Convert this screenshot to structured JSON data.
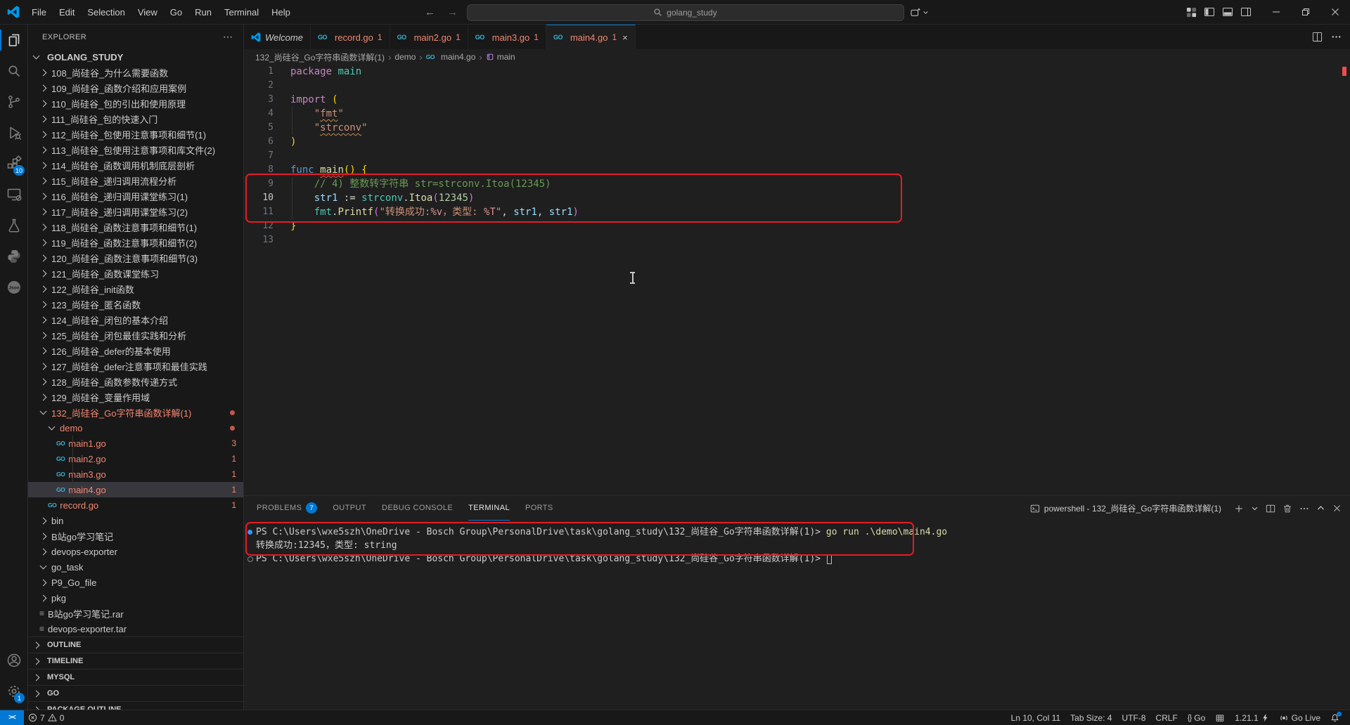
{
  "colors": {
    "accent": "#0078d4",
    "error": "#f14c4c",
    "tree_error": "#f48771",
    "annotation": "#e51c24",
    "go_icon": "#35b5d6",
    "terminal_command": "#dcdcaa"
  },
  "window": {
    "menus": [
      "File",
      "Edit",
      "Selection",
      "View",
      "Go",
      "Run",
      "Terminal",
      "Help"
    ],
    "search_text": "golang_study",
    "nav": {
      "back": "←",
      "forward": "→"
    }
  },
  "activity_bar": {
    "top": [
      {
        "name": "explorer",
        "active": true
      },
      {
        "name": "search"
      },
      {
        "name": "source-control"
      },
      {
        "name": "run-debug"
      },
      {
        "name": "extensions",
        "badge": "10"
      },
      {
        "name": "remote-explorer"
      },
      {
        "name": "testing"
      },
      {
        "name": "python"
      },
      {
        "name": "json"
      }
    ],
    "bottom": [
      {
        "name": "account"
      },
      {
        "name": "settings",
        "badge": "1"
      }
    ]
  },
  "sidebar": {
    "header": "EXPLORER",
    "header_more": "⋯",
    "root": "GOLANG_STUDY",
    "tree": [
      {
        "l": "108_尚硅谷_为什么需要函数",
        "i": 1,
        "k": "fo"
      },
      {
        "l": "109_尚硅谷_函数介绍和应用案例",
        "i": 1,
        "k": "fo"
      },
      {
        "l": "110_尚硅谷_包的引出和使用原理",
        "i": 1,
        "k": "fo"
      },
      {
        "l": "111_尚硅谷_包的快速入门",
        "i": 1,
        "k": "fo"
      },
      {
        "l": "112_尚硅谷_包使用注意事项和细节(1)",
        "i": 1,
        "k": "fo"
      },
      {
        "l": "113_尚硅谷_包使用注意事项和库文件(2)",
        "i": 1,
        "k": "fo"
      },
      {
        "l": "114_尚硅谷_函数调用机制底层剖析",
        "i": 1,
        "k": "fo"
      },
      {
        "l": "115_尚硅谷_递归调用流程分析",
        "i": 1,
        "k": "fo"
      },
      {
        "l": "116_尚硅谷_递归调用课堂练习(1)",
        "i": 1,
        "k": "fo"
      },
      {
        "l": "117_尚硅谷_递归调用课堂练习(2)",
        "i": 1,
        "k": "fo"
      },
      {
        "l": "118_尚硅谷_函数注意事项和细节(1)",
        "i": 1,
        "k": "fo"
      },
      {
        "l": "119_尚硅谷_函数注意事项和细节(2)",
        "i": 1,
        "k": "fo"
      },
      {
        "l": "120_尚硅谷_函数注意事项和细节(3)",
        "i": 1,
        "k": "fo"
      },
      {
        "l": "121_尚硅谷_函数课堂练习",
        "i": 1,
        "k": "fo"
      },
      {
        "l": "122_尚硅谷_init函数",
        "i": 1,
        "k": "fo"
      },
      {
        "l": "123_尚硅谷_匿名函数",
        "i": 1,
        "k": "fo"
      },
      {
        "l": "124_尚硅谷_闭包的基本介绍",
        "i": 1,
        "k": "fo"
      },
      {
        "l": "125_尚硅谷_闭包最佳实践和分析",
        "i": 1,
        "k": "fo"
      },
      {
        "l": "126_尚硅谷_defer的基本使用",
        "i": 1,
        "k": "fo"
      },
      {
        "l": "127_尚硅谷_defer注意事项和最佳实践",
        "i": 1,
        "k": "fo"
      },
      {
        "l": "128_尚硅谷_函数参数传递方式",
        "i": 1,
        "k": "fo"
      },
      {
        "l": "129_尚硅谷_变量作用域",
        "i": 1,
        "k": "fo"
      },
      {
        "l": "132_尚硅谷_Go字符串函数详解(1)",
        "i": 1,
        "k": "fe",
        "e": true,
        "d": true
      },
      {
        "l": "demo",
        "i": 2,
        "k": "fe",
        "e": true,
        "d": true
      },
      {
        "l": "main1.go",
        "i": 3,
        "k": "go",
        "e": true,
        "b": "3"
      },
      {
        "l": "main2.go",
        "i": 3,
        "k": "go",
        "e": true,
        "b": "1"
      },
      {
        "l": "main3.go",
        "i": 3,
        "k": "go",
        "e": true,
        "b": "1"
      },
      {
        "l": "main4.go",
        "i": 3,
        "k": "go",
        "e": true,
        "b": "1",
        "sel": true
      },
      {
        "l": "record.go",
        "i": 2,
        "k": "go",
        "e": true,
        "b": "1"
      },
      {
        "l": "bin",
        "i": 1,
        "k": "fo"
      },
      {
        "l": "B站go学习笔记",
        "i": 1,
        "k": "fo"
      },
      {
        "l": "devops-exporter",
        "i": 1,
        "k": "fo"
      },
      {
        "l": "go_task",
        "i": 1,
        "k": "fe"
      },
      {
        "l": "P9_Go_file",
        "i": 1,
        "k": "fo"
      },
      {
        "l": "pkg",
        "i": 1,
        "k": "fo"
      },
      {
        "l": "B站go学习笔记.rar",
        "i": 1,
        "k": "ar"
      },
      {
        "l": "devops-exporter.tar",
        "i": 1,
        "k": "ar"
      }
    ],
    "sections": [
      "OUTLINE",
      "TIMELINE",
      "MYSQL",
      "GO",
      "PACKAGE OUTLINE"
    ]
  },
  "tabs": [
    {
      "label": "Welcome",
      "icon": "vscode",
      "italic": true
    },
    {
      "label": "record.go",
      "icon": "go",
      "error_count": "1"
    },
    {
      "label": "main2.go",
      "icon": "go",
      "error_count": "1"
    },
    {
      "label": "main3.go",
      "icon": "go",
      "error_count": "1"
    },
    {
      "label": "main4.go",
      "icon": "go",
      "error_count": "1",
      "active": true,
      "close": "×"
    }
  ],
  "breadcrumb": [
    {
      "label": "132_尚硅谷_Go字符串函数详解(1)"
    },
    {
      "label": "demo"
    },
    {
      "label": "main4.go",
      "icon": "go"
    },
    {
      "label": "main",
      "icon": "symbol-namespace"
    }
  ],
  "editor": {
    "lines": [
      {
        "n": "1",
        "t": [
          [
            "package",
            "kw"
          ],
          [
            " ",
            "pl"
          ],
          [
            "main",
            "ns"
          ]
        ]
      },
      {
        "n": "2",
        "t": []
      },
      {
        "n": "3",
        "t": [
          [
            "import",
            "kw"
          ],
          [
            " ",
            "pl"
          ],
          [
            "(",
            "b1"
          ]
        ]
      },
      {
        "n": "4",
        "t": [
          [
            "    ",
            "pl"
          ],
          [
            "\"",
            "str"
          ],
          [
            "fmt",
            "str uw"
          ],
          [
            "\"",
            "str"
          ]
        ]
      },
      {
        "n": "5",
        "t": [
          [
            "    ",
            "pl"
          ],
          [
            "\"",
            "str"
          ],
          [
            "strconv",
            "str uw"
          ],
          [
            "\"",
            "str"
          ]
        ]
      },
      {
        "n": "6",
        "t": [
          [
            ")",
            "b1"
          ]
        ]
      },
      {
        "n": "7",
        "t": []
      },
      {
        "n": "8",
        "t": [
          [
            "func",
            "kw2"
          ],
          [
            " ",
            "pl"
          ],
          [
            "main",
            "fn ue"
          ],
          [
            "()",
            "b1"
          ],
          [
            " ",
            "pl"
          ],
          [
            "{",
            "b1"
          ]
        ]
      },
      {
        "n": "9",
        "t": [
          [
            "    ",
            "pl"
          ],
          [
            "// 4) 整数转字符串 str=strconv.Itoa(12345)",
            "cmt"
          ]
        ]
      },
      {
        "n": "10",
        "cur": true,
        "t": [
          [
            "    ",
            "pl"
          ],
          [
            "str1",
            "vr"
          ],
          [
            " ",
            "pl"
          ],
          [
            ":=",
            "op"
          ],
          [
            " ",
            "pl"
          ],
          [
            "strconv",
            "ns"
          ],
          [
            ".",
            "pl"
          ],
          [
            "Itoa",
            "fn"
          ],
          [
            "(",
            "b2"
          ],
          [
            "12345",
            "num"
          ],
          [
            ")",
            "b2"
          ]
        ]
      },
      {
        "n": "11",
        "t": [
          [
            "    ",
            "pl"
          ],
          [
            "fmt",
            "ns"
          ],
          [
            ".",
            "pl"
          ],
          [
            "Printf",
            "fn"
          ],
          [
            "(",
            "b2"
          ],
          [
            "\"转换成功:",
            "str"
          ],
          [
            "%v",
            "spec"
          ],
          [
            "，类型: ",
            "str"
          ],
          [
            "%T",
            "spec"
          ],
          [
            "\"",
            "str"
          ],
          [
            ", ",
            "pl"
          ],
          [
            "str1",
            "vr"
          ],
          [
            ", ",
            "pl"
          ],
          [
            "str1",
            "vr"
          ],
          [
            ")",
            "b2"
          ]
        ]
      },
      {
        "n": "12",
        "t": [
          [
            "}",
            "b1"
          ]
        ]
      },
      {
        "n": "13",
        "t": []
      }
    ]
  },
  "panel": {
    "tabs": [
      {
        "label": "PROBLEMS",
        "badge": "7"
      },
      {
        "label": "OUTPUT"
      },
      {
        "label": "DEBUG CONSOLE"
      },
      {
        "label": "TERMINAL",
        "active": true
      },
      {
        "label": "PORTS"
      }
    ],
    "terminal_title": "powershell - 132_尚硅谷_Go字符串函数详解(1)",
    "terminal_lines": [
      {
        "deco": "filled",
        "t": [
          [
            "PS C:\\Users\\wxe5szh\\OneDrive - Bosch Group\\PersonalDrive\\task\\golang_study\\132_尚硅谷_Go字符串函数详解(1)> ",
            "pl"
          ],
          [
            "go run .\\demo\\main4.go",
            "cmd"
          ]
        ]
      },
      {
        "deco": "",
        "t": [
          [
            "转换成功:12345，类型: string",
            "pl"
          ]
        ]
      },
      {
        "deco": "hollow",
        "cursor": true,
        "t": [
          [
            "PS C:\\Users\\wxe5szh\\OneDrive - Bosch Group\\PersonalDrive\\task\\golang_study\\132_尚硅谷_Go字符串函数详解(1)> ",
            "pl"
          ]
        ]
      }
    ]
  },
  "status_bar": {
    "remote": "><",
    "errors": "7",
    "warnings": "0",
    "right": [
      {
        "name": "cursor-position",
        "label": "Ln 10, Col 11"
      },
      {
        "name": "indentation",
        "label": "Tab Size: 4"
      },
      {
        "name": "encoding",
        "label": "UTF-8"
      },
      {
        "name": "eol",
        "label": "CRLF"
      },
      {
        "name": "language-mode",
        "icon": "braces",
        "label": "Go"
      },
      {
        "name": "go-tools",
        "icon": "grid",
        "label": ""
      },
      {
        "name": "go-version",
        "label": "1.21.1",
        "icon2": "bolt"
      },
      {
        "name": "go-live",
        "icon": "broadcast",
        "label": "Go Live"
      },
      {
        "name": "notifications",
        "icon": "bell",
        "badge": true,
        "label": ""
      }
    ]
  }
}
